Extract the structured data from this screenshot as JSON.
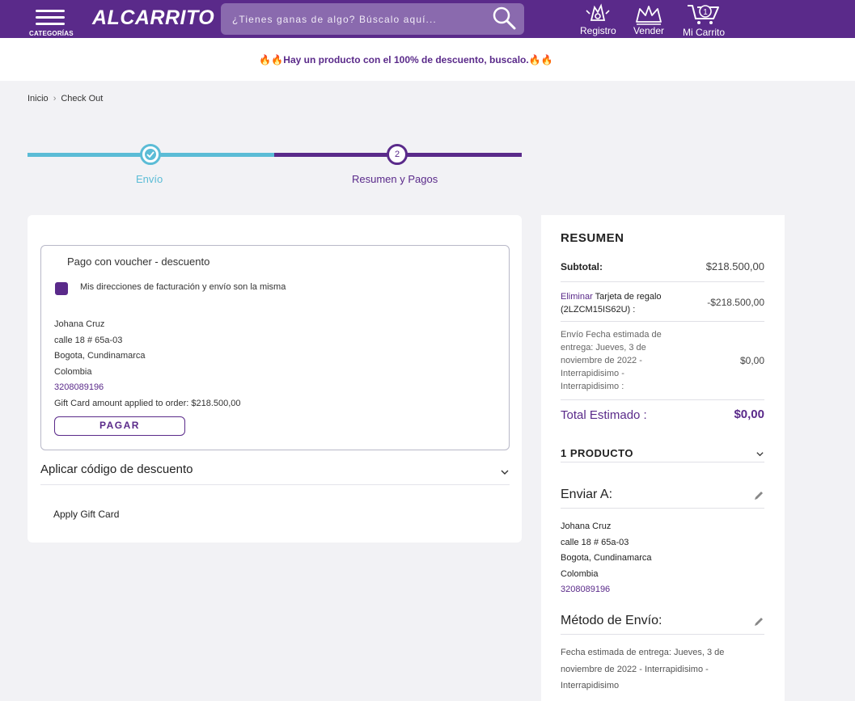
{
  "header": {
    "menu_label": "CATEGORÍAS",
    "logo": "ALCARRITO",
    "search_placeholder": "¿Tienes ganas de algo? Búscalo aquí...",
    "links": {
      "register": "Registro",
      "sell": "Vender",
      "cart": "Mi Carrito",
      "cart_count": "1"
    },
    "colors": {
      "brand": "#5a2a8a",
      "accent": "#5bbcd6"
    }
  },
  "promo": {
    "text": "🔥🔥Hay un producto con el 100% de descuento, buscalo.🔥🔥"
  },
  "breadcrumb": {
    "home": "Inicio",
    "current": "Check Out"
  },
  "steps": {
    "step1_label": "Envío",
    "step2_number": "2",
    "step2_label": "Resumen y Pagos"
  },
  "payment": {
    "voucher_title": "Pago con voucher - descuento",
    "same_address_label": "Mis direcciones de facturación y envío son la misma",
    "same_address_checked": true,
    "address": {
      "name": "Johana Cruz",
      "street": "calle 18 # 65a-03",
      "city": "Bogota, Cundinamarca",
      "country": "Colombia",
      "phone": "3208089196",
      "gift_applied": "Gift Card amount applied to order: $218.500,00"
    },
    "pay_button": "PAGAR",
    "discount_title": "Aplicar código de descuento",
    "gift_card_label": "Apply Gift Card"
  },
  "summary": {
    "title": "RESUMEN",
    "subtotal_label": "Subtotal:",
    "subtotal_value": "$218.500,00",
    "remove_label": "Eliminar",
    "gift_card_line1": "Tarjeta de regalo",
    "gift_card_line2": "(2LZCM15IS62U) :",
    "gift_card_value": "-$218.500,00",
    "shipping_lines": [
      "Envío Fecha estimada de",
      "entrega: Jueves, 3 de",
      "noviembre de 2022 -",
      "Interrapidisimo -",
      "Interrapidisimo :"
    ],
    "shipping_value": "$0,00",
    "total_label": "Total Estimado :",
    "total_value": "$0,00",
    "products_label": "1 PRODUCTO",
    "ship_to_title": "Enviar A:",
    "ship_to": {
      "name": "Johana Cruz",
      "street": "calle 18 # 65a-03",
      "city": "Bogota, Cundinamarca",
      "country": "Colombia",
      "phone": "3208089196"
    },
    "method_title": "Método de Envío:",
    "method_lines": [
      "Fecha estimada de entrega: Jueves, 3 de",
      "noviembre de 2022 - Interrapidisimo -",
      "Interrapidisimo"
    ]
  }
}
